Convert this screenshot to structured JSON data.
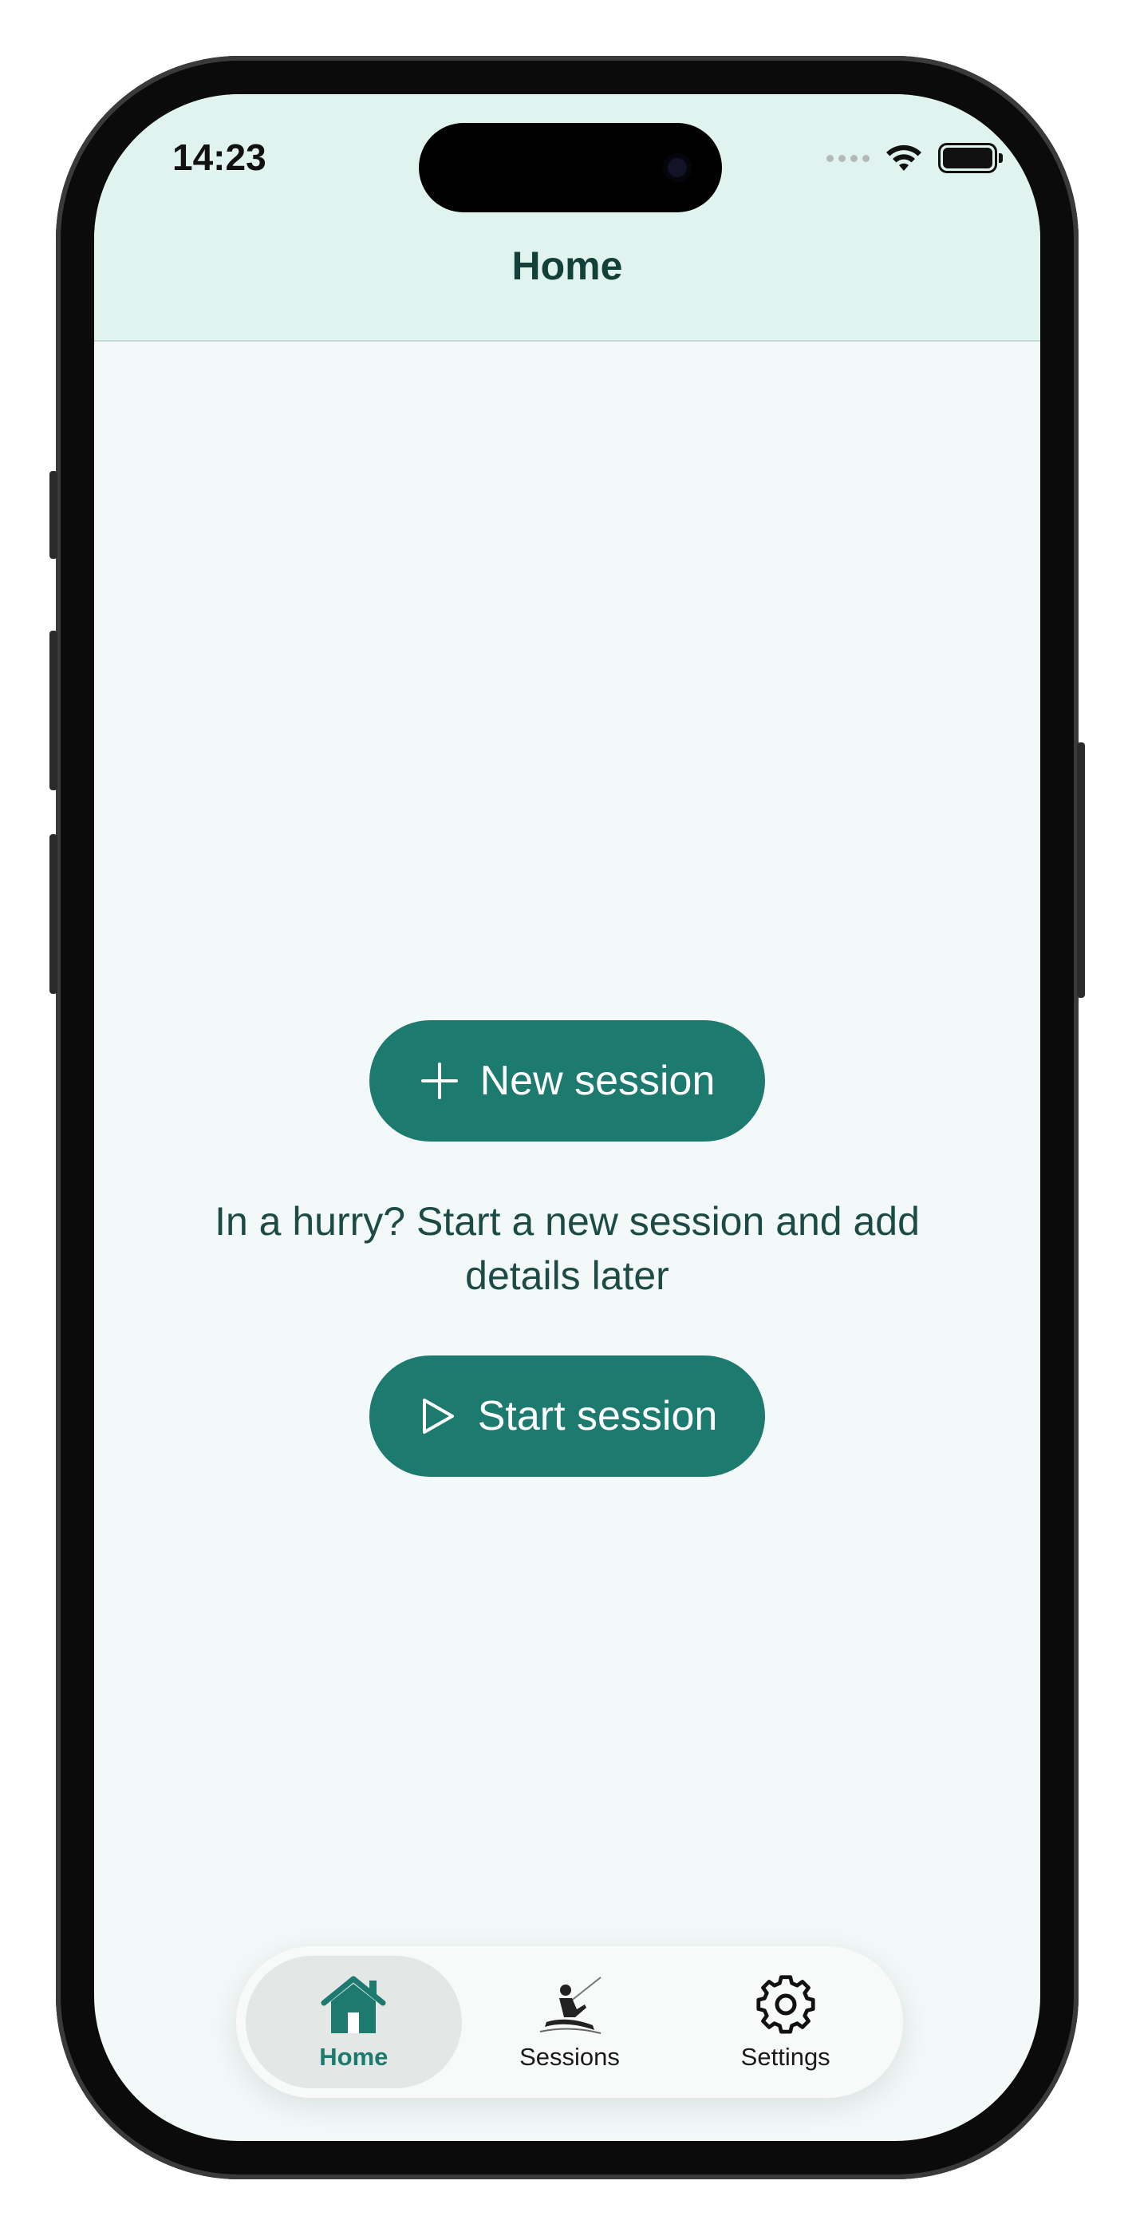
{
  "status_bar": {
    "time": "14:23"
  },
  "header": {
    "title": "Home"
  },
  "main": {
    "new_session_label": "New session",
    "hint_text": "In a hurry? Start a new session and add details later",
    "start_session_label": "Start session"
  },
  "tabbar": {
    "items": [
      {
        "label": "Home",
        "icon": "house-icon",
        "active": true
      },
      {
        "label": "Sessions",
        "icon": "fisherman-icon",
        "active": false
      },
      {
        "label": "Settings",
        "icon": "gear-icon",
        "active": false
      }
    ]
  },
  "colors": {
    "accent": "#1c7a6e",
    "header_bg": "#e0f3ee",
    "page_bg": "#f3f9f8",
    "title_text": "#13413a"
  }
}
